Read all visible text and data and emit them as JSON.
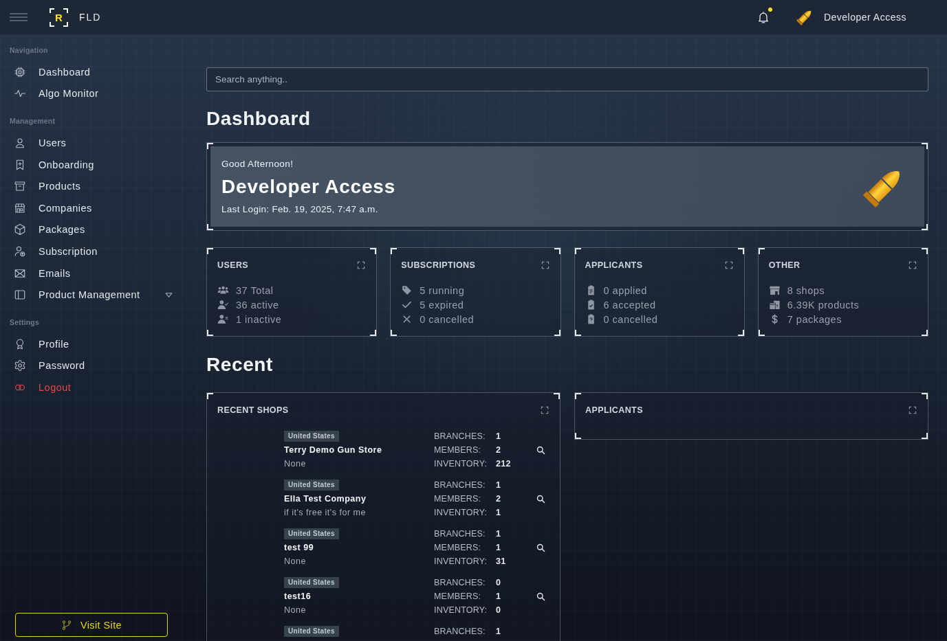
{
  "header": {
    "logo": {
      "mark": "R",
      "name": "FLD"
    },
    "notifications": {
      "unread": true
    },
    "user": {
      "name": "Developer Access"
    }
  },
  "sidebar": {
    "sections": [
      {
        "label": "Navigation",
        "items": [
          {
            "label": "Dashboard",
            "kind": "link"
          },
          {
            "label": "Algo Monitor",
            "kind": "link"
          }
        ]
      },
      {
        "label": "Management",
        "items": [
          {
            "label": "Users",
            "kind": "link"
          },
          {
            "label": "Onboarding",
            "kind": "link"
          },
          {
            "label": "Products",
            "kind": "link"
          },
          {
            "label": "Companies",
            "kind": "link"
          },
          {
            "label": "Packages",
            "kind": "link"
          },
          {
            "label": "Subscription",
            "kind": "link"
          },
          {
            "label": "Emails",
            "kind": "link"
          },
          {
            "label": "Product Management",
            "kind": "dropdown",
            "expanded": false
          }
        ]
      },
      {
        "label": "Settings",
        "items": [
          {
            "label": "Profile",
            "kind": "link"
          },
          {
            "label": "Password",
            "kind": "link"
          },
          {
            "label": "Logout",
            "kind": "danger"
          }
        ]
      }
    ],
    "visit_button": "Visit Site"
  },
  "search": {
    "placeholder": "Search anything.."
  },
  "page_title": "Dashboard",
  "welcome": {
    "greeting": "Good Afternoon!",
    "name": "Developer Access",
    "last_login": "Last Login: Feb. 19, 2025, 7:47 a.m."
  },
  "stat_cards": [
    {
      "title": "USERS",
      "rows": [
        "37 Total",
        "36 active",
        "1 inactive"
      ]
    },
    {
      "title": "SUBSCRIPTIONS",
      "rows": [
        "5 running",
        "5 expired",
        "0 cancelled"
      ]
    },
    {
      "title": "APPLICANTS",
      "rows": [
        "0 applied",
        "6 accepted",
        "0 cancelled"
      ]
    },
    {
      "title": "OTHER",
      "rows": [
        "8 shops",
        "6.39K products",
        "7 packages"
      ]
    }
  ],
  "recent": {
    "title": "Recent",
    "shops_card": {
      "title": "RECENT SHOPS",
      "shops": [
        {
          "country": "United States",
          "name": "Terry Demo Gun Store",
          "description": "None",
          "stats": [
            {
              "label": "BRANCHES:",
              "value": "1"
            },
            {
              "label": "MEMBERS:",
              "value": "2"
            },
            {
              "label": "INVENTORY:",
              "value": "212"
            }
          ]
        },
        {
          "country": "United States",
          "name": "Ella Test Company",
          "description": "if it's free it's for me",
          "stats": [
            {
              "label": "BRANCHES:",
              "value": "1"
            },
            {
              "label": "MEMBERS:",
              "value": "2"
            },
            {
              "label": "INVENTORY:",
              "value": "1"
            }
          ]
        },
        {
          "country": "United States",
          "name": "test 99",
          "description": "None",
          "stats": [
            {
              "label": "BRANCHES:",
              "value": "1"
            },
            {
              "label": "MEMBERS:",
              "value": "1"
            },
            {
              "label": "INVENTORY:",
              "value": "31"
            }
          ]
        },
        {
          "country": "United States",
          "name": "test16",
          "description": "None",
          "stats": [
            {
              "label": "BRANCHES:",
              "value": "0"
            },
            {
              "label": "MEMBERS:",
              "value": "1"
            },
            {
              "label": "INVENTORY:",
              "value": "0"
            }
          ]
        },
        {
          "country": "United States",
          "stats": [
            {
              "label": "BRANCHES:",
              "value": "1"
            }
          ]
        }
      ]
    },
    "applicants_card": {
      "title": "APPLICANTS"
    }
  }
}
